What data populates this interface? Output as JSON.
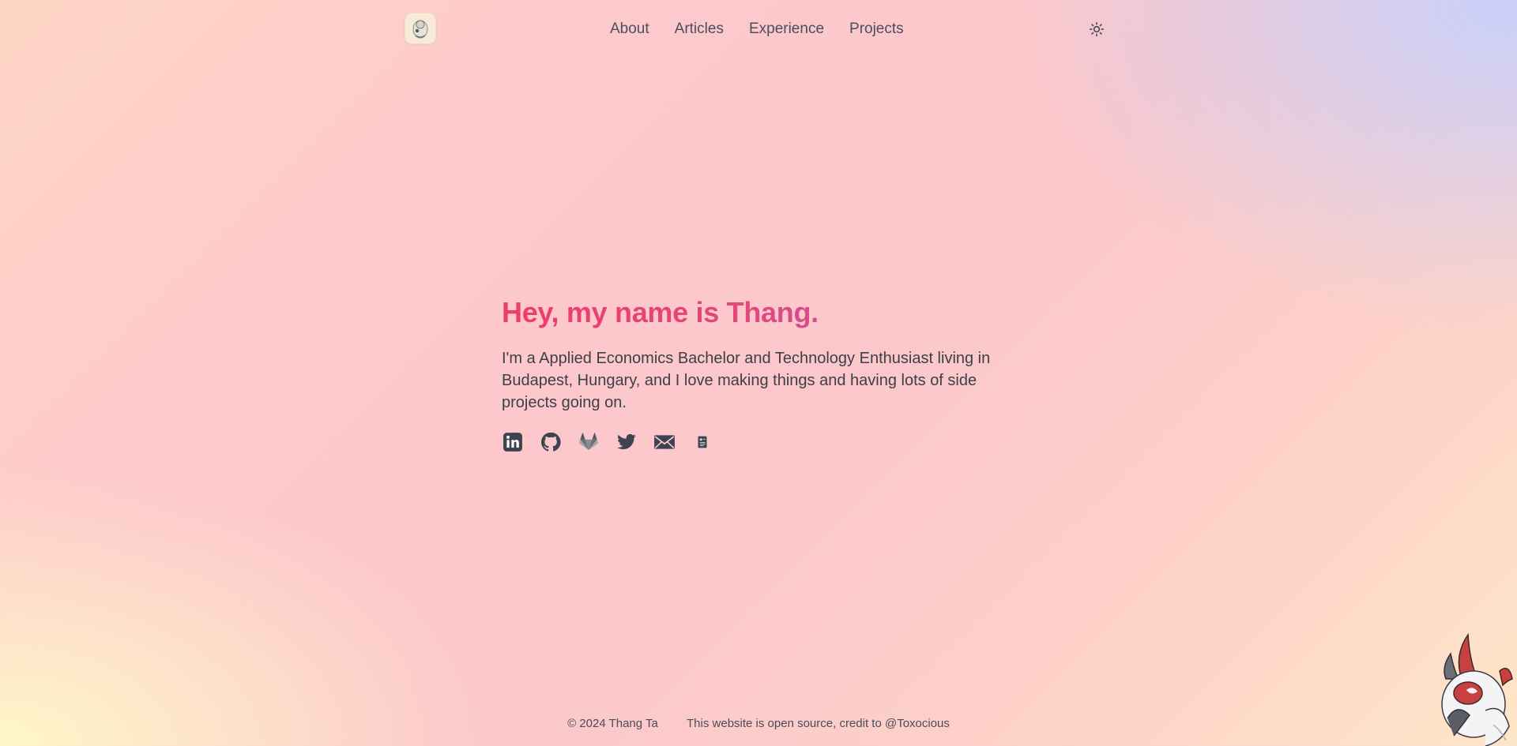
{
  "header": {
    "logo_icon": "avatar-icon",
    "nav": [
      {
        "label": "About"
      },
      {
        "label": "Articles"
      },
      {
        "label": "Experience"
      },
      {
        "label": "Projects"
      }
    ],
    "theme_toggle_icon": "sun-icon"
  },
  "hero": {
    "title": "Hey, my name is Thang.",
    "bio": "I'm a Applied Economics Bachelor and Technology Enthusiast living in Budapest, Hungary, and I love making things and having lots of side projects going on.",
    "socials": [
      {
        "icon": "linkedin-icon"
      },
      {
        "icon": "github-icon"
      },
      {
        "icon": "gitlab-icon"
      },
      {
        "icon": "twitter-icon"
      },
      {
        "icon": "mail-icon"
      },
      {
        "icon": "resume-document-icon"
      }
    ]
  },
  "footer": {
    "copyright": "© 2024 Thang Ta",
    "credit": "This website is open source, credit to @Toxocious"
  },
  "colors": {
    "title_gradient_start": "#ec3d6a",
    "title_gradient_end": "#b05ac6",
    "text": "#3d3f48",
    "icon": "#3f4350"
  }
}
